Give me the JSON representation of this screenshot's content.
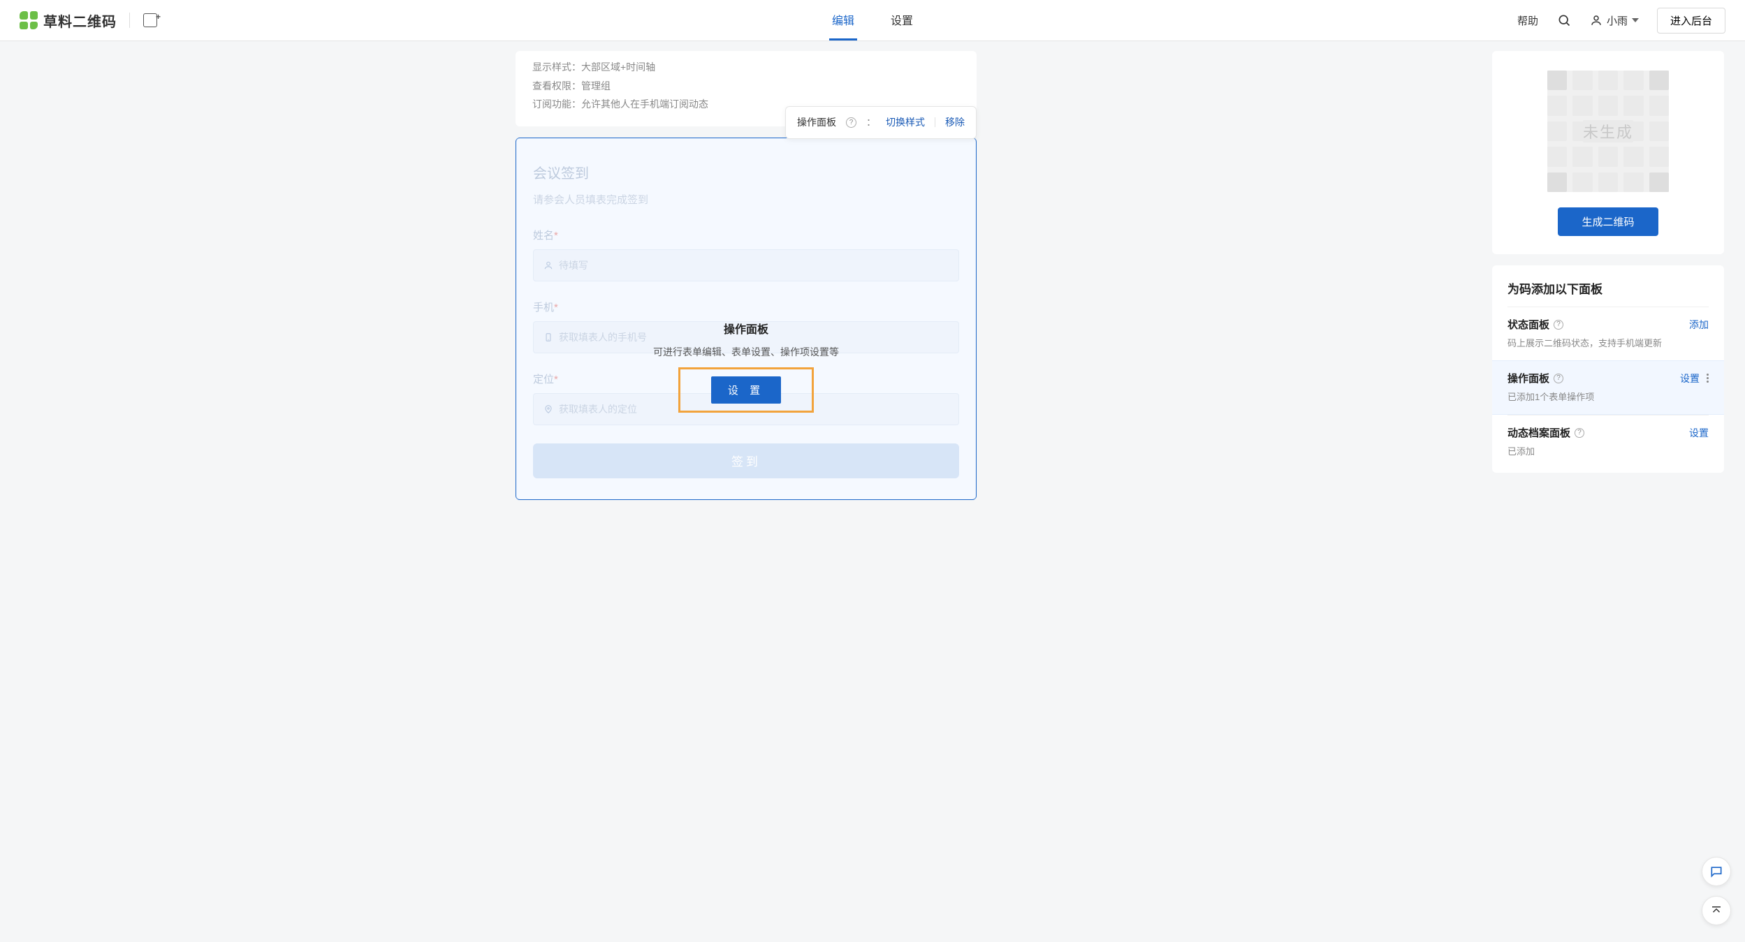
{
  "header": {
    "logo_text": "草料二维码",
    "tabs": {
      "edit": "编辑",
      "settings": "设置"
    },
    "help": "帮助",
    "user_name": "小雨",
    "enter_admin": "进入后台"
  },
  "info_card": {
    "rows": [
      {
        "label": "显示样式：",
        "value": "大部区域+时间轴"
      },
      {
        "label": "查看权限：",
        "value": "管理组"
      },
      {
        "label": "订阅功能：",
        "value": "允许其他人在手机端订阅动态"
      }
    ]
  },
  "hover_bar": {
    "title": "操作面板",
    "switch_style": "切换样式",
    "remove": "移除",
    "colon": "："
  },
  "form": {
    "title": "会议签到",
    "subtitle": "请参会人员填表完成签到",
    "fields": {
      "name": {
        "label": "姓名",
        "placeholder": "待填写"
      },
      "phone": {
        "label": "手机",
        "placeholder": "获取填表人的手机号"
      },
      "location": {
        "label": "定位",
        "placeholder": "获取填表人的定位"
      }
    },
    "submit": "签到"
  },
  "popover": {
    "title": "操作面板",
    "desc": "可进行表单编辑、表单设置、操作项设置等",
    "button": "设 置"
  },
  "qr": {
    "placeholder_text": "未生成",
    "generate": "生成二维码"
  },
  "panels": {
    "heading": "为码添加以下面板",
    "items": [
      {
        "name": "状态面板",
        "desc": "码上展示二维码状态，支持手机端更新",
        "action": "添加"
      },
      {
        "name": "操作面板",
        "desc": "已添加1个表单操作项",
        "action": "设置"
      },
      {
        "name": "动态档案面板",
        "desc": "已添加",
        "action": "设置"
      }
    ]
  }
}
